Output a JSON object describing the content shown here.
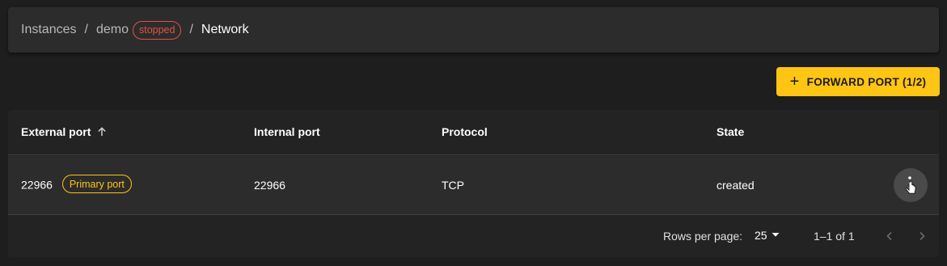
{
  "breadcrumb": {
    "instances": "Instances",
    "separator": "/",
    "instance_name": "demo",
    "instance_status": "stopped",
    "current": "Network"
  },
  "toolbar": {
    "forward_port_label": "FORWARD PORT (1/2)",
    "forward_port_icon": "plus-icon"
  },
  "table": {
    "columns": [
      "External port",
      "Internal port",
      "Protocol",
      "State"
    ],
    "sort": {
      "column": "External port",
      "direction": "ascending",
      "icon": "arrow-up-icon"
    },
    "rows": [
      {
        "external_port": "22966",
        "badge": "Primary port",
        "internal_port": "22966",
        "protocol": "TCP",
        "state": "created",
        "actions_icon": "more-vertical-icon"
      }
    ]
  },
  "pagination": {
    "rows_per_page_label": "Rows per page:",
    "rows_per_page_value": "25",
    "range": "1–1 of 1",
    "prev_icon": "chevron-left-icon",
    "next_icon": "chevron-right-icon"
  },
  "colors": {
    "background": "#1e1e1e",
    "surface": "#2c2c2c",
    "accent": "#fec514",
    "stopped": "#e0514a"
  }
}
